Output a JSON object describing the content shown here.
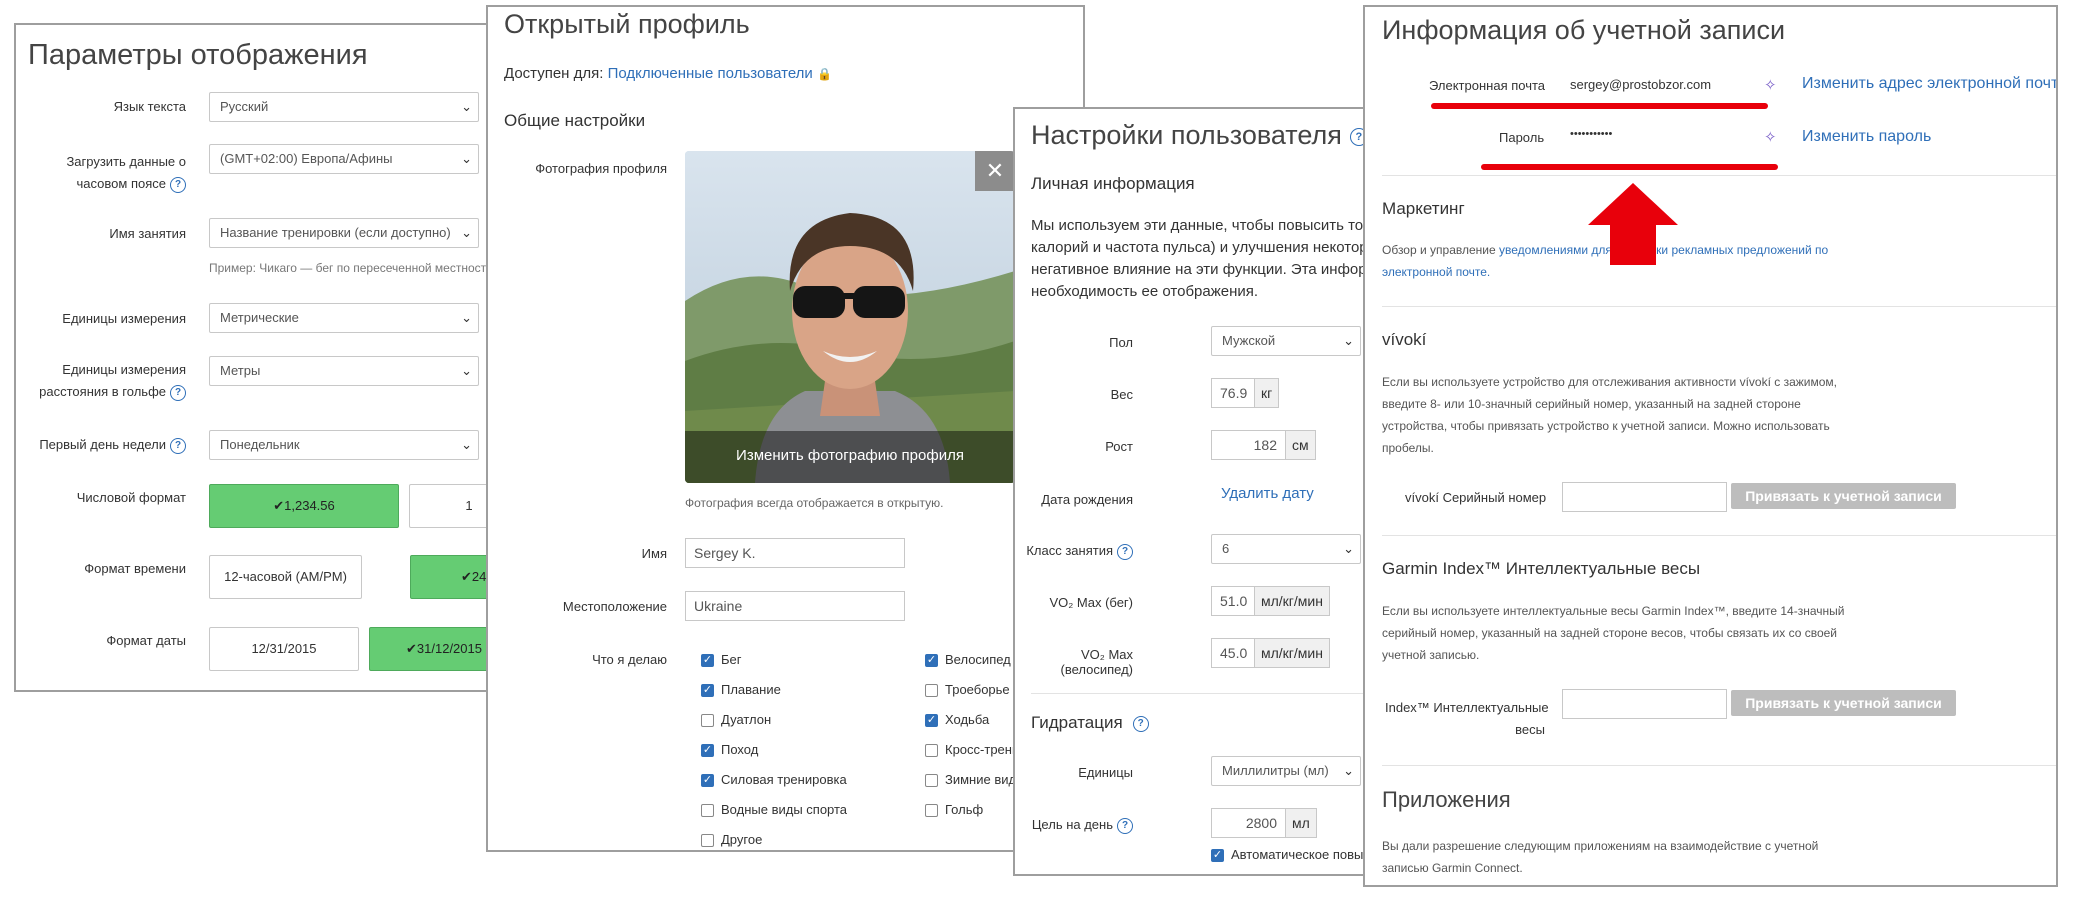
{
  "display": {
    "title": "Параметры отображения",
    "language_label": "Язык текста",
    "language_value": "Русский",
    "timezone_label_1": "Загрузить данные о",
    "timezone_label_2": "часовом поясе",
    "timezone_value": "(GMT+02:00) Европа/Афины",
    "activity_name_label": "Имя занятия",
    "activity_name_value": "Название тренировки (если доступно)",
    "activity_name_hint": "Пример: Чикаго — бег по пересеченной местности",
    "units_label": "Единицы измерения",
    "units_value": "Метрические",
    "golf_units_label_1": "Единицы измерения",
    "golf_units_label_2": "расстояния в гольфе",
    "golf_units_value": "Метры",
    "week_start_label": "Первый день недели",
    "week_start_value": "Понедельник",
    "number_format_label": "Числовой формат",
    "number_format_options": [
      "1,234.56",
      "1"
    ],
    "time_format_label": "Формат времени",
    "time_format_options": [
      "12-часовой (AM/PM)",
      "24"
    ],
    "date_format_label": "Формат даты",
    "date_format_options": [
      "12/31/2015",
      "31/12/2015"
    ]
  },
  "profile": {
    "title": "Открытый профиль",
    "available_label": "Доступен для:",
    "available_value": "Подключенные пользователи",
    "general_title": "Общие настройки",
    "photo_label": "Фотография профиля",
    "change_photo": "Изменить фотографию профиля",
    "photo_close": "✕",
    "photo_note": "Фотография всегда отображается в открытую.",
    "name_label": "Имя",
    "name_value": "Sergey K.",
    "location_label": "Местоположение",
    "location_value": "Ukraine",
    "activities_label": "Что я делаю",
    "activities_col1": [
      {
        "label": "Бег",
        "checked": true
      },
      {
        "label": "Плавание",
        "checked": true
      },
      {
        "label": "Дуатлон",
        "checked": false
      },
      {
        "label": "Поход",
        "checked": true
      },
      {
        "label": "Силовая тренировка",
        "checked": true
      },
      {
        "label": "Водные виды спорта",
        "checked": false
      },
      {
        "label": "Другое",
        "checked": false
      }
    ],
    "activities_col2": [
      {
        "label": "Велосипед",
        "checked": true
      },
      {
        "label": "Троеборье",
        "checked": false
      },
      {
        "label": "Ходьба",
        "checked": true
      },
      {
        "label": "Кросс-трени",
        "checked": false
      },
      {
        "label": "Зимние вид",
        "checked": false
      },
      {
        "label": "Гольф",
        "checked": false
      }
    ]
  },
  "user": {
    "title": "Настройки пользователя",
    "personal_title": "Личная информация",
    "intro_lines": [
      "Мы используем эти данные, чтобы повысить точ",
      "калорий и частота пульса) и улучшения некотор",
      "негативное влияние на эти функции. Эта инфор",
      "необходимость ее отображения."
    ],
    "gender_label": "Пол",
    "gender_value": "Мужской",
    "weight_label": "Вес",
    "weight_value": "76.9",
    "weight_unit": "кг",
    "height_label": "Рост",
    "height_value": "182",
    "height_unit": "см",
    "birthdate_label": "Дата рождения",
    "birthdate_action": "Удалить дату",
    "activity_class_label": "Класс занятия",
    "activity_class_value": "6",
    "vo2_run_label": "VO₂ Max (бег)",
    "vo2_run_value": "51.0",
    "vo2_bike_label": "VO₂ Max (велосипед)",
    "vo2_bike_value": "45.0",
    "vo2_unit": "мл/кг/мин",
    "hydration_title": "Гидратация",
    "hydration_units_label": "Единицы",
    "hydration_units_value": "Миллилитры (мл)",
    "daily_goal_label": "Цель на день",
    "daily_goal_value": "2800",
    "daily_goal_unit": "мл",
    "auto_label": "Автоматическое повы"
  },
  "account": {
    "title": "Информация об учетной записи",
    "email_label": "Электронная почта",
    "email_value": "sergey@prostobzor.com",
    "change_email": "Изменить адрес электронной почты",
    "password_label": "Пароль",
    "password_value": "•••••••••••",
    "change_password": "Изменить пароль",
    "marketing_title": "Маркетинг",
    "marketing_text_1": "Обзор и управление ",
    "marketing_link_1": "уведомлениями для рассылки рекламных предложений по",
    "marketing_link_2": "электронной почте.",
    "vivoki_title": "vívokí",
    "vivoki_text": [
      "Если вы используете устройство для отслеживания активности vívokí с зажимом,",
      "введите 8- или 10-значный серийный номер, указанный на задней стороне",
      "устройства, чтобы привязать устройство к учетной записи. Можно использовать",
      "пробелы."
    ],
    "vivoki_serial_label": "vívokí Серийный номер",
    "link_button": "Привязать к учетной записи",
    "index_title": "Garmin Index™ Интеллектуальные весы",
    "index_text": [
      "Если вы используете интеллектуальные весы Garmin Index™, введите 14-значный",
      "серийный номер, указанный на задней стороне весов, чтобы связать их со своей",
      "учетной записью."
    ],
    "index_label_1": "Index™ Интеллектуальные",
    "index_label_2": "весы",
    "apps_title": "Приложения",
    "apps_text": [
      "Вы дали разрешение следующим приложениям на взаимодействие с учетной",
      "записью Garmin Connect."
    ]
  },
  "colors": {
    "accent": "#2f6fb8",
    "selected_green": "#65cc73",
    "annotation_red": "#e8000b",
    "disabled_button": "#bdbdbd"
  },
  "icons": [
    "help-icon",
    "chevron-down-icon",
    "lock-icon",
    "close-icon",
    "check-icon",
    "sparkle-icon",
    "red-arrow-up"
  ]
}
